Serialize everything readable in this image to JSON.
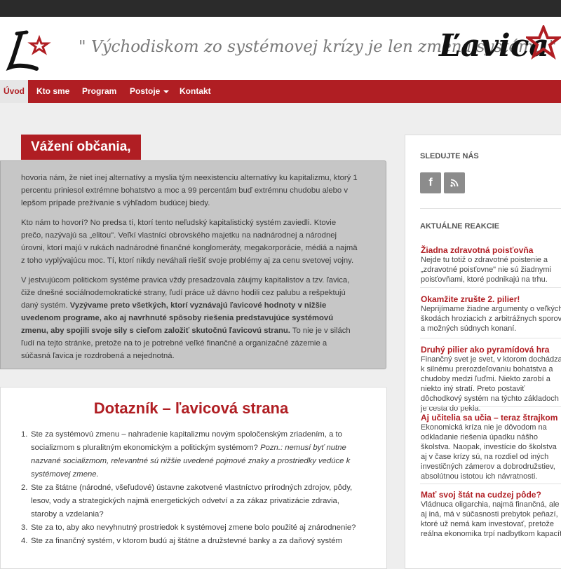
{
  "header": {
    "tagline": "\" Východiskom zo systémovej krízy je len zmena systému \"",
    "logo_text": "Ľavica",
    "brand_color": "#b01e23"
  },
  "nav": {
    "items": [
      {
        "label": "Úvod",
        "active": true
      },
      {
        "label": "Kto sme"
      },
      {
        "label": "Program"
      },
      {
        "label": "Postoje"
      },
      {
        "label": "Kontakt"
      }
    ]
  },
  "intro": {
    "title": "Vážení občania,",
    "p1": "hovoria nám, že niet inej alternatívy a myslia tým neexistenciu alternatívy ku kapitalizmu, ktorý 1 percentu priniesol extrémne bohatstvo a moc a 99 percentám buď extrémnu chudobu alebo v lepšom prípade prežívanie s výhľadom budúcej biedy.",
    "p2": "Kto nám to hovorí? No predsa tí, ktorí tento neľudský kapitalistický systém zaviedli. Ktovie prečo, nazývajú sa „elitou\". Veľkí vlastníci obrovského majetku na nadnárodnej a národnej úrovni, ktorí majú v rukách nadnárodné finančné konglomeráty, megakorporácie, médiá a najmä z toho vyplývajúcu moc. Tí, ktorí nikdy neváhali riešiť svoje problémy aj za cenu svetovej vojny.",
    "p3_start": "V jestvujúcom politickom systéme pravica vždy presadzovala záujmy kapitalistov a tzv. ľavica, čiže dnešné sociálnodemokratické strany, ľudí práce už dávno hodili cez palubu a rešpektujú daný systém. ",
    "p3_bold": "Vyzývame preto všetkých, ktorí vyznávajú ľavicové hodnoty v nižšie uvedenom programe, ako aj navrhnuté spôsoby riešenia predstavujúce systémovú zmenu, aby spojili svoje sily s cieľom založiť skutočnú ľavicovú stranu.",
    "p3_end": " To nie je v silách ľudí na tejto stránke, pretože na to je potrebné veľké finančné a organizačné zázemie a súčasná ľavica je rozdrobená a nejednotná."
  },
  "survey": {
    "title": "Dotazník – ľavicová strana",
    "items": [
      {
        "num": "1.",
        "text": "Ste za systémovú zmenu – nahradenie kapitalizmu novým spoločenským zriadením, a to socializmom s pluralitným ekonomickým a politickým systémom? ",
        "note": "Pozn.: nemusí byť nutne nazvané socializmom, relevantné sú nižšie uvedené pojmové znaky a prostriedky vedúce k systémovej zmene."
      },
      {
        "num": "2.",
        "text": "Ste za štátne (národné, všeľudové) ústavne zakotvené vlastníctvo prírodných zdrojov, pôdy, lesov, vody a strategických najmä energetických odvetví a za zákaz privatizácie zdravia, staroby a vzdelania?"
      },
      {
        "num": "3.",
        "text": "Ste za to, aby ako nevyhnutný prostriedok k systémovej zmene bolo použité aj znárodnenie?"
      },
      {
        "num": "4.",
        "text": "Ste za finančný systém, v ktorom budú aj štátne a družstevné banky a za daňový systém"
      }
    ]
  },
  "sidebar": {
    "follow_heading": "SLEDUJTE NÁS",
    "social": [
      {
        "icon": "facebook-icon",
        "glyph": "f"
      },
      {
        "icon": "rss-icon",
        "glyph": "⌁"
      }
    ],
    "reactions_heading": "AKTUÁLNE REAKCIE",
    "reactions": [
      {
        "title": "Žiadna zdravotná poisťovňa",
        "text": "Nejde tu totiž o zdravotné poistenie a „zdravotné poisťovne\" nie sú žiadnymi poisťovňami, ktoré podnikajú na trhu."
      },
      {
        "title": "Okamžite zrušte 2. pilier!",
        "text": "Neprijímame žiadne argumenty o veľkých škodách hroziacich z arbitrážnych sporov a možných súdnych konaní."
      },
      {
        "title": "Druhý pilier ako pyramídová hra",
        "text": "Finančný svet je svet, v ktorom dochádza k silnému prerozdeľovaniu bohatstva a chudoby medzi ľuďmi. Niekto zarobí a niekto iný stratí. Preto postaviť dôchodkový systém na týchto základoch je cesta do pekla."
      },
      {
        "title": "Aj učitelia sa učia – teraz štrajkom",
        "text": "Ekonomická kríza nie je dôvodom na odkladanie riešenia úpadku nášho školstva. Naopak, investície do školstva aj v čase krízy sú, na rozdiel od iných investičných zámerov a dobrodružstiev, absolútnou istotou ich návratnosti."
      },
      {
        "title": "Mať svoj štát na cudzej pôde?",
        "text": "Vládnuca oligarchia, najmä finančná, ale aj iná, má v súčasnosti prebytok peňazí, ktoré už nemá kam investovať, pretože reálna ekonomika trpí nadbytkom kapacít."
      }
    ]
  }
}
